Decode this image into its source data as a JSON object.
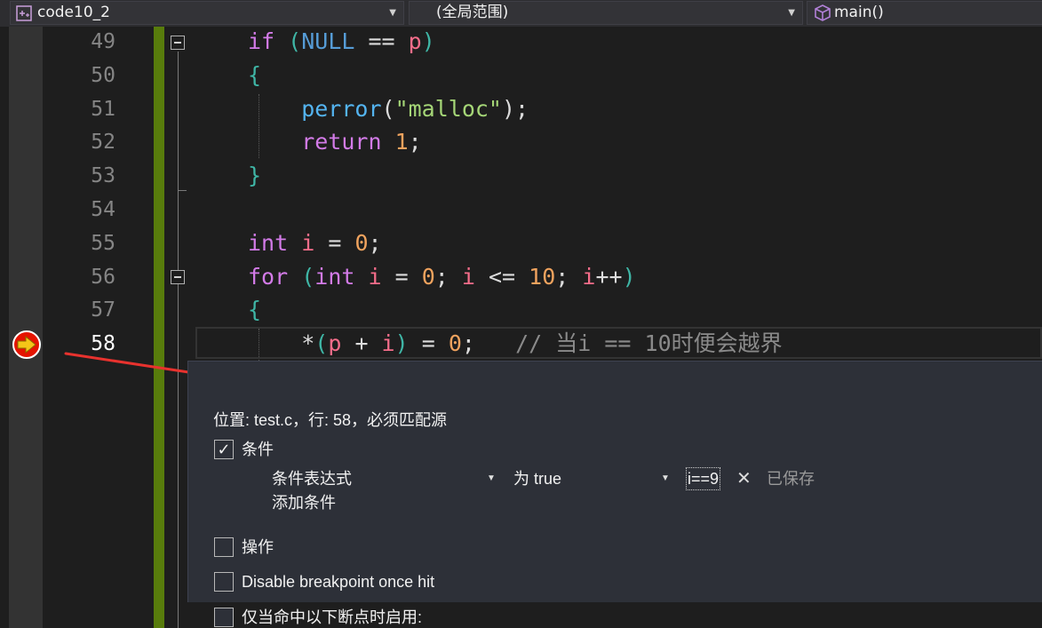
{
  "navbar": {
    "project": "code10_2",
    "scope": "(全局范围)",
    "member": "main()"
  },
  "editor": {
    "line_numbers": [
      "49",
      "50",
      "51",
      "52",
      "53",
      "54",
      "55",
      "56",
      "57",
      "58"
    ],
    "lines": [
      [
        {
          "t": "if ",
          "c": "kw"
        },
        {
          "t": "(",
          "c": "br"
        },
        {
          "t": "NULL",
          "c": "kw2"
        },
        {
          "t": " == ",
          "c": "op"
        },
        {
          "t": "p",
          "c": "var"
        },
        {
          "t": ")",
          "c": "br"
        }
      ],
      [
        {
          "t": "{",
          "c": "br"
        }
      ],
      [
        {
          "t": "    perror",
          "c": "fn"
        },
        {
          "t": "(",
          "c": "op"
        },
        {
          "t": "\"malloc\"",
          "c": "str"
        },
        {
          "t": ");",
          "c": "op"
        }
      ],
      [
        {
          "t": "    return ",
          "c": "kw"
        },
        {
          "t": "1",
          "c": "num"
        },
        {
          "t": ";",
          "c": "op"
        }
      ],
      [
        {
          "t": "}",
          "c": "br"
        }
      ],
      [],
      [
        {
          "t": "int ",
          "c": "kw"
        },
        {
          "t": "i",
          "c": "var"
        },
        {
          "t": " = ",
          "c": "op"
        },
        {
          "t": "0",
          "c": "num"
        },
        {
          "t": ";",
          "c": "op"
        }
      ],
      [
        {
          "t": "for ",
          "c": "kw"
        },
        {
          "t": "(",
          "c": "br"
        },
        {
          "t": "int ",
          "c": "kw"
        },
        {
          "t": "i",
          "c": "var"
        },
        {
          "t": " = ",
          "c": "op"
        },
        {
          "t": "0",
          "c": "num"
        },
        {
          "t": "; ",
          "c": "op"
        },
        {
          "t": "i",
          "c": "var"
        },
        {
          "t": " <= ",
          "c": "op"
        },
        {
          "t": "10",
          "c": "num"
        },
        {
          "t": "; ",
          "c": "op"
        },
        {
          "t": "i",
          "c": "var"
        },
        {
          "t": "++",
          "c": "op"
        },
        {
          "t": ")",
          "c": "br"
        }
      ],
      [
        {
          "t": "{",
          "c": "br"
        }
      ],
      [
        {
          "t": "    *",
          "c": "op"
        },
        {
          "t": "(",
          "c": "br"
        },
        {
          "t": "p",
          "c": "var"
        },
        {
          "t": " + ",
          "c": "op"
        },
        {
          "t": "i",
          "c": "var"
        },
        {
          "t": ")",
          "c": "br"
        },
        {
          "t": " = ",
          "c": "op"
        },
        {
          "t": "0",
          "c": "num"
        },
        {
          "t": ";   ",
          "c": "op"
        },
        {
          "t": "// 当i == 10时便会越界",
          "c": "cm"
        }
      ]
    ]
  },
  "breakpoint_settings": {
    "location": "位置: test.c，行: 58，必须匹配源",
    "conditions": {
      "label": "条件",
      "checked": true,
      "type_select": "条件表达式",
      "mode_select": "为 true",
      "expression": "i==9",
      "saved_label": "已保存",
      "add_condition": "添加条件"
    },
    "actions": {
      "label": "操作",
      "checked": false
    },
    "disable_once_hit": {
      "label": "Disable breakpoint once hit",
      "checked": false
    },
    "dependent": {
      "label": "仅当命中以下断点时启用:",
      "checked": false
    }
  },
  "colors": {
    "kw": "#d37be8",
    "kw2": "#569cd6",
    "var": "#f56d8a",
    "num": "#f0a35e",
    "fn": "#54b4f0",
    "str": "#a5d677",
    "br": "#3fb6a6",
    "cm": "#8a8a8a",
    "op": "#dcdcdc",
    "change_bar": "#587c0c",
    "arrow": "#e8322e"
  }
}
